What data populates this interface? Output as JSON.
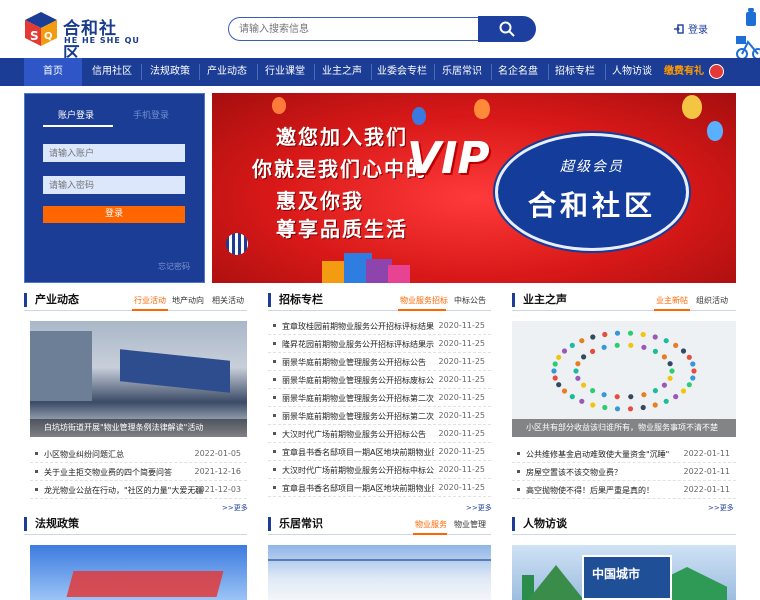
{
  "header": {
    "logo_cn": "合和社区",
    "logo_en": "HE HE SHE QU",
    "search_placeholder": "请输入搜索信息",
    "login_label": "登录"
  },
  "nav": {
    "items": [
      "首页",
      "信用社区",
      "法规政策",
      "产业动态",
      "行业课堂",
      "业主之声",
      "业委会专栏",
      "乐居常识",
      "名企名盘",
      "招标专栏",
      "人物访谈"
    ],
    "active_index": 0,
    "pay_label": "缴费有礼"
  },
  "login": {
    "tab_account": "账户登录",
    "tab_phone": "手机登录",
    "account_placeholder": "请输入账户",
    "password_placeholder": "请输入密码",
    "submit_label": "登录",
    "forgot_label": "忘记密码"
  },
  "banner": {
    "line1": "邀您加入我们",
    "line2": "你就是我们心中的",
    "vip": "VIP",
    "line3": "惠及你我",
    "line4": "尊享品质生活",
    "oval_sub": "超级会员",
    "oval_main": "合和社区"
  },
  "industry": {
    "title": "产业动态",
    "tabs": [
      "行业活动",
      "地产动向",
      "相关活动"
    ],
    "caption": "白坑坊街道开展\"物业管理条例法律解读\"活动",
    "items": [
      {
        "text": "小区物业纠纷问题汇总",
        "date": "2022-01-05"
      },
      {
        "text": "关于业主拒交物业费的四个简要问答",
        "date": "2021-12-16"
      },
      {
        "text": "龙光物业公益在行动，\"社区的力量\"大爱无疆",
        "date": "2021-12-03"
      }
    ],
    "more": ">>更多"
  },
  "tender": {
    "title": "招标专栏",
    "tabs": [
      "物业服务招标",
      "中标公告"
    ],
    "items": [
      {
        "text": "宜章玫桂园前期物业服务公开招标评标结果...",
        "date": "2020-11-25"
      },
      {
        "text": "隆昇花园前期物业服务公开招标评标结果示",
        "date": "2020-11-25"
      },
      {
        "text": "丽景华庭前期物业管理服务公开招标公告",
        "date": "2020-11-25"
      },
      {
        "text": "丽景华庭前期物业管理服务公开招标废标公告",
        "date": "2020-11-25"
      },
      {
        "text": "丽景华庭前期物业管理服务公开招标第二次...",
        "date": "2020-11-25"
      },
      {
        "text": "丽景华庭前期物业管理服务公开招标第二次...",
        "date": "2020-11-25"
      },
      {
        "text": "大汉时代广场前期物业服务公开招标公告",
        "date": "2020-11-25"
      },
      {
        "text": "宜章县书香名邸项目一期A区地块前期物业服...",
        "date": "2020-11-25"
      },
      {
        "text": "大汉时代广场前期物业服务公开招标中标公告",
        "date": "2020-11-25"
      },
      {
        "text": "宜章县书香名邸项目一期A区地块前期物业服...",
        "date": "2020-11-25"
      }
    ],
    "more": ">>更多"
  },
  "owners": {
    "title": "业主之声",
    "tabs": [
      "业主新帖",
      "组织活动"
    ],
    "caption": "小区共有部分收益该归谁所有，物业服务事项不清不楚",
    "items": [
      {
        "text": "公共维修基金启动难致使大量资金\"沉睡\"",
        "date": "2022-01-11"
      },
      {
        "text": "房屋空置该不该交物业费？",
        "date": "2022-01-11"
      },
      {
        "text": "高空抛物使不得！后果严重是真的！",
        "date": "2022-01-11"
      }
    ],
    "more": ">>更多"
  },
  "law": {
    "title": "法规政策"
  },
  "living": {
    "title": "乐居常识",
    "tabs": [
      "物业服务",
      "物业管理"
    ]
  },
  "interview": {
    "title": "人物访谈",
    "img_text": "中国城市"
  },
  "colors": {
    "nav": "#1c3d96",
    "accent": "#ff6600",
    "banner": "#d81818"
  }
}
